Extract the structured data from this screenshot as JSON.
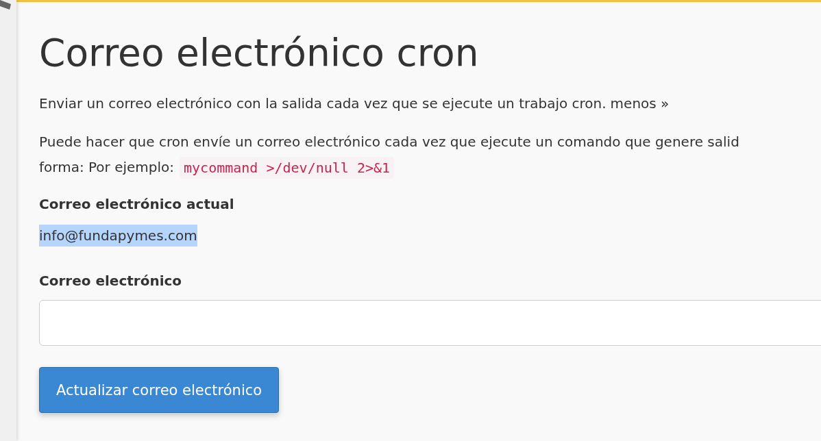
{
  "title": "Correo electrónico cron",
  "intro": {
    "text": "Enviar un correo electrónico con la salida cada vez que se ejecute un trabajo cron.",
    "link": "menos »"
  },
  "help": {
    "line_1": "Puede hacer que cron envíe un correo electrónico cada vez que ejecute un comando que genere salid",
    "line_2": "forma: Por ejemplo:",
    "code": "mycommand >/dev/null 2>&1"
  },
  "current_email": {
    "label": "Correo electrónico actual",
    "value": "info@fundapymes.com",
    "selected": true
  },
  "email_field": {
    "label": "Correo electrónico"
  },
  "buttons": [
    {
      "label": "Actualizar correo electrónico",
      "kind": "primary"
    }
  ]
}
